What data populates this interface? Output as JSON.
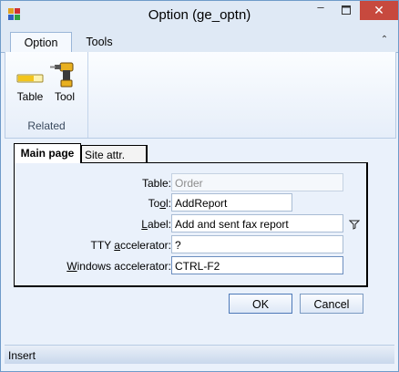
{
  "window": {
    "title": "Option (ge_optn)",
    "minimize": "–",
    "close": "✕"
  },
  "ribbon": {
    "tabs": [
      {
        "label": "Option",
        "active": true
      },
      {
        "label": "Tools",
        "active": false
      }
    ],
    "collapse_glyph": "⌃",
    "groups": [
      {
        "label": "Related",
        "buttons": [
          {
            "label": "Table",
            "icon": "table-icon"
          },
          {
            "label": "Tool",
            "icon": "drill-icon"
          }
        ]
      }
    ]
  },
  "tabs": [
    {
      "label": "Main page",
      "active": true
    },
    {
      "label": "Site attr.",
      "active": false
    }
  ],
  "form": {
    "table": {
      "label_pre": "",
      "label_u": "",
      "label_post": "Table:",
      "value": "Order"
    },
    "tool": {
      "label_pre": "To",
      "label_u": "o",
      "label_post": "l:",
      "value": "AddReport"
    },
    "label": {
      "label_pre": "",
      "label_u": "L",
      "label_post": "abel:",
      "value": "Add and sent fax report"
    },
    "tty": {
      "label_pre": "TTY ",
      "label_u": "a",
      "label_post": "ccelerator:",
      "value": "?"
    },
    "windows": {
      "label_pre": "",
      "label_u": "W",
      "label_post": "indows accelerator:",
      "value": "CTRL-F2"
    }
  },
  "buttons": {
    "ok": "OK",
    "cancel": "Cancel"
  },
  "status": {
    "text": "Insert"
  },
  "colors": {
    "accent": "#6f9bc9",
    "close": "#c7493e"
  }
}
